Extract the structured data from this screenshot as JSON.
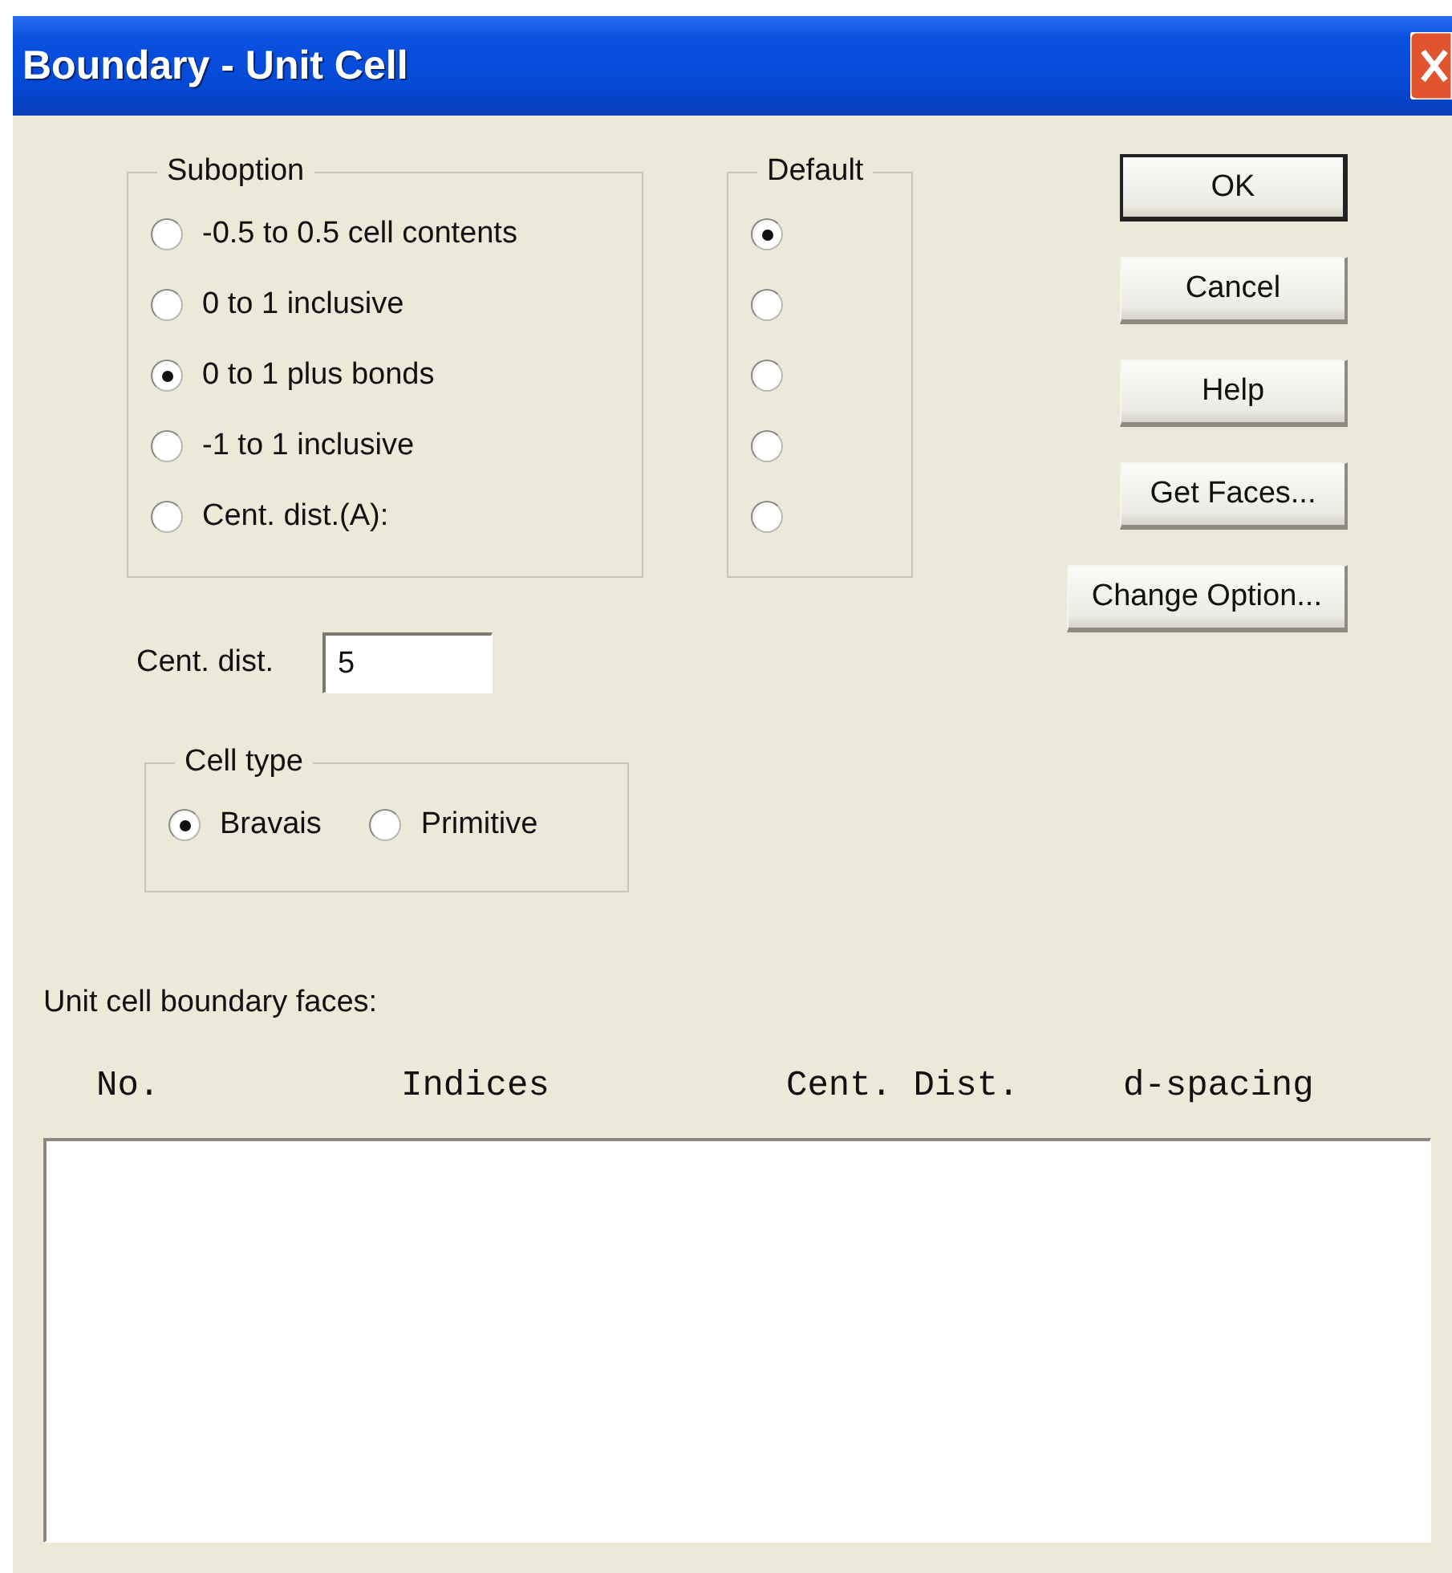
{
  "window": {
    "title": "Boundary - Unit Cell"
  },
  "suboption": {
    "label": "Suboption",
    "options": [
      {
        "label": "-0.5 to 0.5 cell contents",
        "selected": false
      },
      {
        "label": "0 to 1 inclusive",
        "selected": false
      },
      {
        "label": "0 to 1 plus bonds",
        "selected": true
      },
      {
        "label": "-1 to 1 inclusive",
        "selected": false
      },
      {
        "label": "Cent. dist.(A):",
        "selected": false
      }
    ]
  },
  "default": {
    "label": "Default",
    "options": [
      {
        "selected": true
      },
      {
        "selected": false
      },
      {
        "selected": false
      },
      {
        "selected": false
      },
      {
        "selected": false
      }
    ]
  },
  "buttons": [
    {
      "label": "OK",
      "default": true
    },
    {
      "label": "Cancel",
      "default": false
    },
    {
      "label": "Help",
      "default": false
    },
    {
      "label": "Get Faces...",
      "default": false
    },
    {
      "label": "Change Option...",
      "default": false
    }
  ],
  "cent_dist": {
    "label": "Cent. dist.",
    "value": "5"
  },
  "cell_type": {
    "label": "Cell type",
    "options": [
      {
        "label": "Bravais",
        "selected": true
      },
      {
        "label": "Primitive",
        "selected": false
      }
    ]
  },
  "faces": {
    "label": "Unit cell boundary faces:",
    "columns": [
      "No.",
      "Indices",
      "Cent. Dist.",
      "d-spacing"
    ]
  }
}
